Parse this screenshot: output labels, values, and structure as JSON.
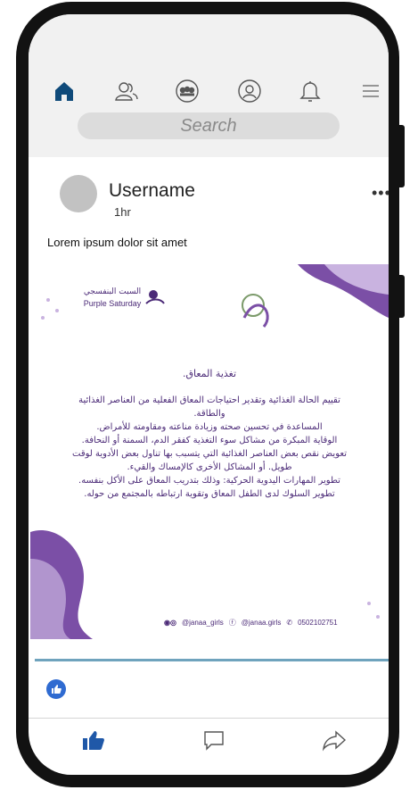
{
  "nav": {
    "icons": [
      "home-icon",
      "friends-icon",
      "groups-icon",
      "profile-icon",
      "bell-icon",
      "menu-icon"
    ]
  },
  "search": {
    "placeholder": "Search"
  },
  "post": {
    "username": "Username",
    "time": "1hr",
    "caption": "Lorem ipsum dolor sit amet",
    "more_label": "•••"
  },
  "flyer": {
    "logo_left_ar": "السبت البنفسجي",
    "logo_left_en": "Purple Saturday",
    "title": "تغذية المعاق.",
    "lines": [
      "تقييم الحالة الغذائية وتقدير احتياجات المعاق الفعلية من العناصر الغذائية",
      "والطاقة.",
      "المساعدة في تحسين صحته وزيادة مناعته ومقاومته للأمراض.",
      "الوقاية المبكرة من مشاكل سوء التغذية كفقر الدم، السمنة أو النحافة.",
      "تعويض نقص بعض العناصر الغذائية التي يتسبب بها تناول بعض الأدوية لوقت",
      "طويل. أو المشاكل الأخرى كالإمساك والقيء.",
      "تطوير المهارات اليدوية الحركية: وذلك بتدريب المعاق على الأكل بنفسه.",
      "تطوير السلوك لدى الطفل المعاق وتقوية ارتباطه بالمجتمع من حوله."
    ],
    "social_handle_1": "@janaa_girls",
    "social_handle_2": "@janaa.girls",
    "phone": "0502102751"
  },
  "colors": {
    "purple": "#7b4fa6",
    "deep_purple": "#4b2a77",
    "lavender": "#c9b3e0",
    "like_blue": "#2f6bd1",
    "home_blue": "#0f4a7a",
    "action_blue": "#1f58a8"
  },
  "actions": [
    "like-icon",
    "comment-icon",
    "share-icon"
  ]
}
